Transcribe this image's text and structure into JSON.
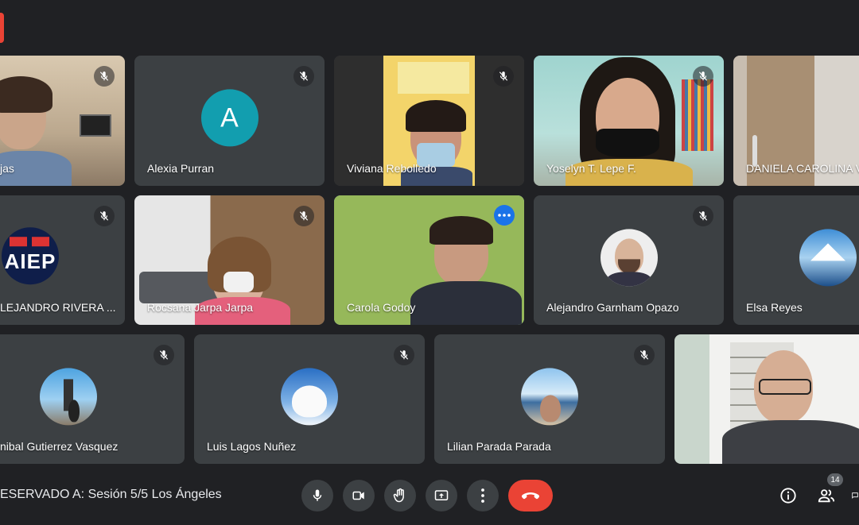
{
  "meeting": {
    "title": "ESERVADO A: Sesión 5/5 Los Ángeles"
  },
  "participants_count": "14",
  "tiles": {
    "t1": {
      "name": "jas"
    },
    "t2": {
      "name": "Alexia Purran",
      "initial": "A"
    },
    "t3": {
      "name": "Viviana Rebolledo"
    },
    "t4": {
      "name": "Yoselyn T. Lepe F."
    },
    "t5": {
      "name": "DANIELA CAROLINA V"
    },
    "t6": {
      "name": "LEJANDRO RIVERA ...",
      "logo_text": "AIEP"
    },
    "t7": {
      "name": "Rocsana Jarpa Jarpa"
    },
    "t8": {
      "name": "Carola Godoy"
    },
    "t9": {
      "name": "Alejandro Garnham Opazo"
    },
    "t10": {
      "name": "Elsa Reyes"
    },
    "t11": {
      "name": "nibal Gutierrez Vasquez"
    },
    "t12": {
      "name": "Luis Lagos Nuñez"
    },
    "t13": {
      "name": "Lilian Parada Parada"
    },
    "t14": {
      "name": ""
    }
  },
  "colors": {
    "end_call": "#ea4335",
    "highlight": "#8ab4f8",
    "avatar_teal": "#129eaf"
  },
  "icons": {
    "mute": "mic-off-icon",
    "mic": "mic-icon",
    "camera": "camera-icon",
    "hand": "raise-hand-icon",
    "present": "present-icon",
    "more": "more-vert-icon",
    "end": "call-end-icon",
    "info": "info-icon",
    "people": "people-icon",
    "chat": "chat-icon"
  }
}
